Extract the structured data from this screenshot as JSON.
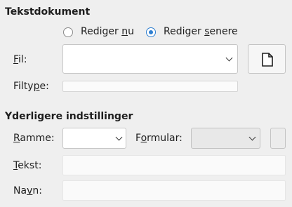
{
  "document_section": {
    "title": "Tekstdokument",
    "radio_edit_now": {
      "prefix": "Rediger ",
      "accel": "n",
      "suffix": "u",
      "checked": false
    },
    "radio_edit_later": {
      "prefix": "Rediger ",
      "accel": "s",
      "suffix": "enere",
      "checked": true
    },
    "file_label": {
      "accel": "F",
      "rest": "il:"
    },
    "file_value": "",
    "filetype_label": {
      "prefix": "Filty",
      "accel": "p",
      "suffix": "e:"
    },
    "filetype_value": "",
    "new_document_icon": "document-icon"
  },
  "more_settings": {
    "title": "Yderligere indstillinger",
    "frame_label": {
      "accel": "R",
      "rest": "amme:"
    },
    "frame_value": "",
    "form_label": {
      "prefix": "F",
      "accel": "o",
      "suffix": "rmular:"
    },
    "form_value": "",
    "text_label": {
      "accel": "T",
      "rest": "ekst:"
    },
    "text_value": "",
    "name_label": {
      "prefix": "Na",
      "accel": "v",
      "suffix": "n:"
    },
    "name_value": ""
  },
  "colors": {
    "accent": "#2f7fd0",
    "background": "#efefef"
  }
}
